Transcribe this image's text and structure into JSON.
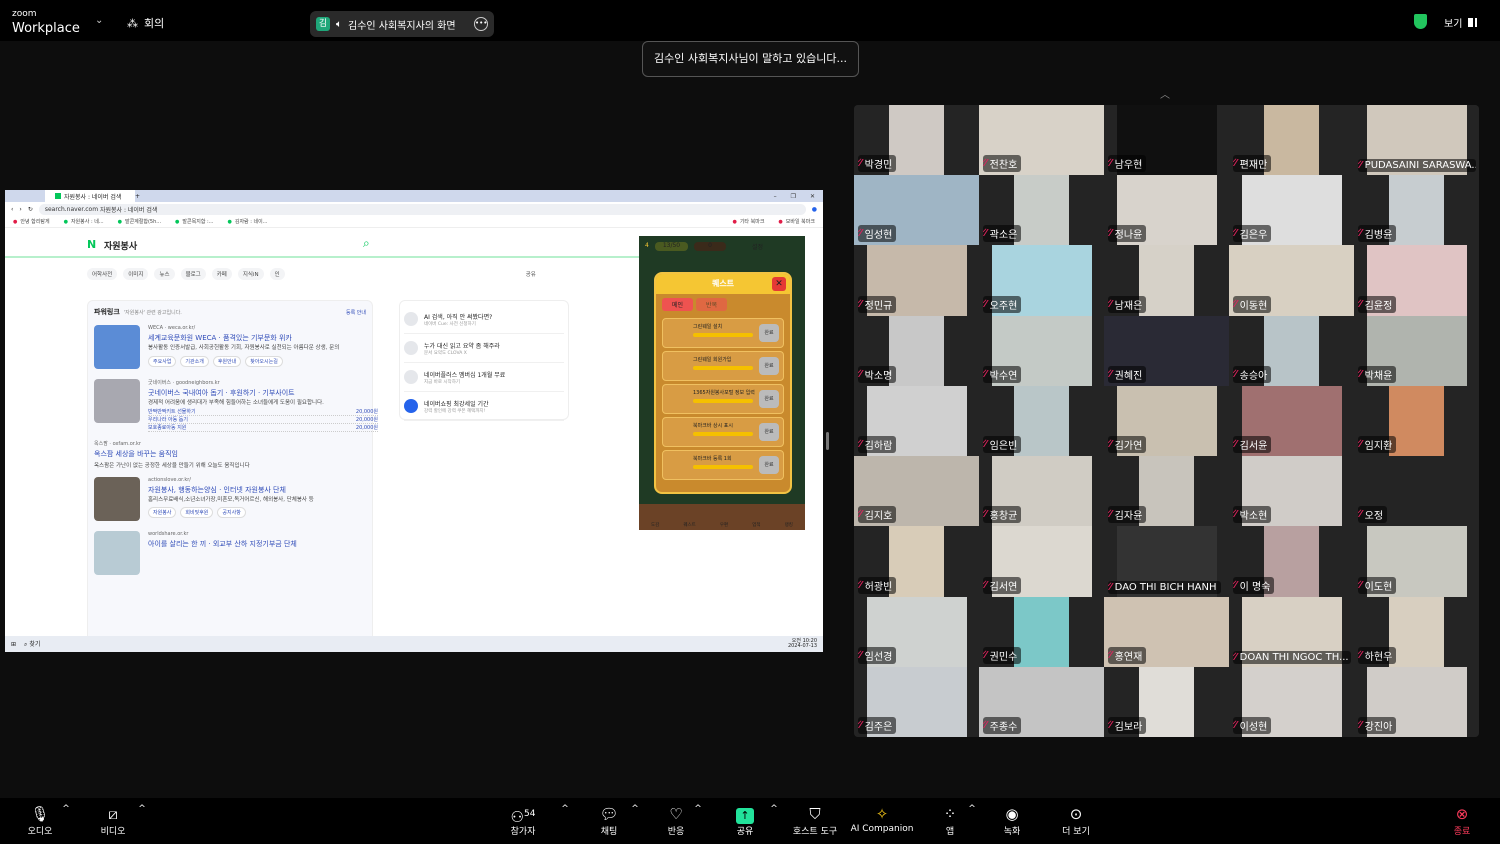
{
  "app": {
    "logo_small": "zoom",
    "logo_big": "Workplace",
    "meeting_label": "회의",
    "share_pill": "김수인 사회복지사의 화면",
    "share_badge": "김",
    "view_label": "보기",
    "speaking": "김수인 사회복지사님이 말하고 있습니다..."
  },
  "browser": {
    "tab_title": "자원봉사 : 네이버 검색",
    "url": "search.naver.com",
    "url_title": "자원봉사 : 네이버 검색",
    "bookmarks": [
      "안녕 합리탐게",
      "자원봉사 : 네...",
      "발콘계절합(5h...",
      "발콘목지합 :...",
      "김자람 : 네이..."
    ],
    "bookmark_folders": [
      "기타 북마크",
      "모바일 북마크"
    ],
    "query": "자원봉사",
    "nav_tabs": [
      "어학사전",
      "이미지",
      "뉴스",
      "블로그",
      "카페",
      "지식iN",
      "인"
    ],
    "share": "공유",
    "powerlink_title": "파워링크",
    "powerlink_sub": "'자원봉사' 관련 광고입니다.",
    "register": "등록 안내",
    "ads": [
      {
        "src": "WECA · weca.or.kr/",
        "title": "세계교육문화원 WECA · 품격있는 기부문화 위카",
        "desc": "봉사활동 인증서발급, 사회공헌활동 기회, 자원봉사로 실천되는 아름다운 상생, 문의",
        "chips": [
          "주요사업",
          "기관소개",
          "후원안내",
          "찾아오시는길"
        ]
      },
      {
        "src": "굿네이버스 · goodneighbors.kr",
        "title": "굿네이버스 국내여아 돕기 · 후원하기 · 기부사이트",
        "desc": "경제적 어려움에 생리대가 부족해 힘들어하는 소녀들에게 도움이 필요합니다.",
        "prices": [
          [
            "반짝반짝키트 선물하기",
            "20,000원"
          ],
          [
            "우리나라 아동 돕기",
            "20,000원"
          ],
          [
            "보호종료아동 지원",
            "20,000원"
          ]
        ]
      },
      {
        "src": "옥스팜 · oxfam.or.kr",
        "title": "옥스팜 세상을 바꾸는 움직임",
        "desc": "옥스팜은 가난이 없는 공정한 세상을 만들기 위해 오늘도 움직입니다"
      },
      {
        "src": "actionslove.or.kr/",
        "title": "자원봉사, 행동하는양심 · 인터넷 자원봉사 단체",
        "desc": "홈리스무료배식,소년소녀가장,미혼모,독거어르신, 해외봉사, 단체봉사 등",
        "chips": [
          "자원봉사",
          "회비및후원",
          "공지사항"
        ]
      },
      {
        "src": "worldshare.or.kr",
        "title": "아이를 살리는 한 끼 · 외교부 산하 지정기부금 단체"
      }
    ],
    "side": [
      {
        "title": "AI 검색, 아직 안 써봤다면?",
        "sub": "네이버 Cue: 사전 신청하기"
      },
      {
        "title": "누가 대신 읽고 요약 좀 해주라",
        "sub": "문서 요약도 CLOVA X"
      },
      {
        "title": "네이버플러스 멤버십 1개월 무료",
        "sub": "지금 바로 시작하기"
      },
      {
        "title": "네이버쇼핑 최강세일 기간",
        "sub": "강력 할인에 강력 쿠폰 혜택까지!"
      }
    ],
    "game": {
      "level": "4",
      "xp": "13/50",
      "potion": "0",
      "settings": "설정",
      "title": "퀘스트",
      "tabs": [
        "메인",
        "반복"
      ],
      "quests": [
        {
          "name": "그린웨일 설치",
          "reward": "x3"
        },
        {
          "name": "그린웨일 회원가입",
          "reward": "x3"
        },
        {
          "name": "1365자원봉사포털 정보 입력",
          "reward": "x3"
        },
        {
          "name": "북마크바 상시 표시",
          "reward": "x5"
        },
        {
          "name": "북마크바 등록 1회",
          "reward": "x5"
        }
      ],
      "done": "완료",
      "progress": "0/1",
      "nav": [
        "도감",
        "퀘스트",
        "우편",
        "업적",
        "랭킹"
      ]
    },
    "taskbar": {
      "search": "찾기",
      "time": "오전 10:20",
      "date": "2024-07-13"
    }
  },
  "participants": [
    {
      "name": "박경민",
      "tone": "#cfc9c4"
    },
    {
      "name": "전찬호",
      "tone": "#d8d2c8"
    },
    {
      "name": "남우현",
      "tone": "#101010"
    },
    {
      "name": "편재만",
      "tone": "#c9b8a0"
    },
    {
      "name": "PUDASAINI SARASWA...",
      "tone": "#d0c8bc"
    },
    {
      "name": "임성현",
      "tone": "#9fb5c5"
    },
    {
      "name": "곽소은",
      "tone": "#c8ccc8"
    },
    {
      "name": "정나윤",
      "tone": "#d8d3cc"
    },
    {
      "name": "김은우",
      "tone": "#dedede"
    },
    {
      "name": "김병윤",
      "tone": "#c7cdd0"
    },
    {
      "name": "정민규",
      "tone": "#c6b9aa"
    },
    {
      "name": "오주현",
      "tone": "#a9d4df"
    },
    {
      "name": "남재은",
      "tone": "#d6d1c8"
    },
    {
      "name": "이동현",
      "tone": "#d8d0c2"
    },
    {
      "name": "김윤정",
      "tone": "#e0c4c4"
    },
    {
      "name": "박소명",
      "tone": "#c8c8c8"
    },
    {
      "name": "박수연",
      "tone": "#c4cac6"
    },
    {
      "name": "권혜진",
      "tone": "#2a2a35"
    },
    {
      "name": "송승아",
      "tone": "#b8c4c8"
    },
    {
      "name": "박채윤",
      "tone": "#b0b4ae"
    },
    {
      "name": "김하람",
      "tone": "#d0d0d0"
    },
    {
      "name": "임은빈",
      "tone": "#b9c6c8"
    },
    {
      "name": "김가연",
      "tone": "#c9c0b0"
    },
    {
      "name": "김서윤",
      "tone": "#a07070"
    },
    {
      "name": "임지환",
      "tone": "#d08a60"
    },
    {
      "name": "김지호",
      "tone": "#bdb6ac"
    },
    {
      "name": "홍창균",
      "tone": "#d0ccc4"
    },
    {
      "name": "김자윤",
      "tone": "#c8c4bc"
    },
    {
      "name": "박소현",
      "tone": "#d0ccc8"
    },
    {
      "name": "오정",
      "tone": "#242424"
    },
    {
      "name": "허광빈",
      "tone": "#d8ccb8"
    },
    {
      "name": "김서연",
      "tone": "#dcd8d0"
    },
    {
      "name": "DAO THI BICH HANH",
      "tone": "#333"
    },
    {
      "name": "이 명숙",
      "tone": "#b8a0a0"
    },
    {
      "name": "이도현",
      "tone": "#c8c8c0"
    },
    {
      "name": "임선경",
      "tone": "#cfd2d0"
    },
    {
      "name": "권민수",
      "tone": "#7cc8c8"
    },
    {
      "name": "홍연재",
      "tone": "#cfc2b2"
    },
    {
      "name": "DOAN THI NGOC TH...",
      "tone": "#d8d0c4"
    },
    {
      "name": "하현우",
      "tone": "#d8cfc0"
    },
    {
      "name": "김주은",
      "tone": "#c8ccd0"
    },
    {
      "name": "주종수",
      "tone": "#c4c4c4"
    },
    {
      "name": "김보라",
      "tone": "#e0ddd8"
    },
    {
      "name": "이성현",
      "tone": "#d4d0cc"
    },
    {
      "name": "강진아",
      "tone": "#d0ccc8"
    }
  ],
  "toolbar": {
    "audio": "오디오",
    "video": "비디오",
    "participants": "참가자",
    "participant_count": "54",
    "chat": "채팅",
    "react": "반응",
    "share": "공유",
    "host_tools": "호스트 도구",
    "ai": "AI Companion",
    "apps": "앱",
    "record": "녹화",
    "more": "더 보기",
    "end": "종료"
  }
}
